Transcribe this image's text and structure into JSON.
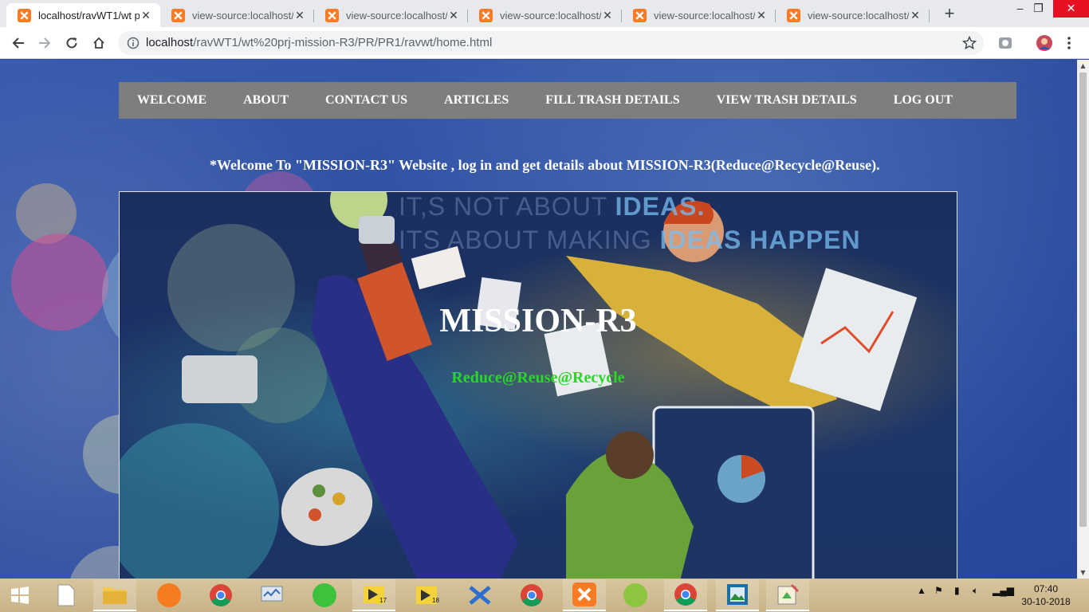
{
  "browser": {
    "tabs": [
      {
        "title": "localhost/ravWT1/wt p",
        "active": true
      },
      {
        "title": "view-source:localhost/",
        "active": false
      },
      {
        "title": "view-source:localhost/",
        "active": false
      },
      {
        "title": "view-source:localhost/",
        "active": false
      },
      {
        "title": "view-source:localhost/",
        "active": false
      },
      {
        "title": "view-source:localhost/",
        "active": false
      }
    ],
    "url_host": "localhost",
    "url_path": "/ravWT1/wt%20prj-mission-R3/PR/PR1/ravwt/home.html"
  },
  "page": {
    "nav": [
      "WELCOME",
      "ABOUT",
      "CONTACT US",
      "ARTICLES",
      "FILL TRASH DETAILS",
      "VIEW TRASH DETAILS",
      "LOG OUT"
    ],
    "welcome_text": "*Welcome To \"MISSION-R3\" Website , log in and get details about MISSION-R3(Reduce@Recycle@Reuse).",
    "hero": {
      "title": "MISSION-R3",
      "subtitle": "Reduce@Reuse@Recycle",
      "bg_line1_a": "IT,S NOT ABOUT ",
      "bg_line1_b": "IDEAS.",
      "bg_line2_a": "ITS ABOUT MAKING ",
      "bg_line2_b": "IDEAS HAPPEN"
    }
  },
  "taskbar": {
    "badges": {
      "vlc17": "17",
      "vlc18": "18"
    },
    "clock_time": "07:40",
    "clock_date": "30-10-2018"
  },
  "colors": {
    "nav_bg": "#7e7e7e",
    "subtitle_green": "#27d924",
    "close_red": "#e81123"
  }
}
